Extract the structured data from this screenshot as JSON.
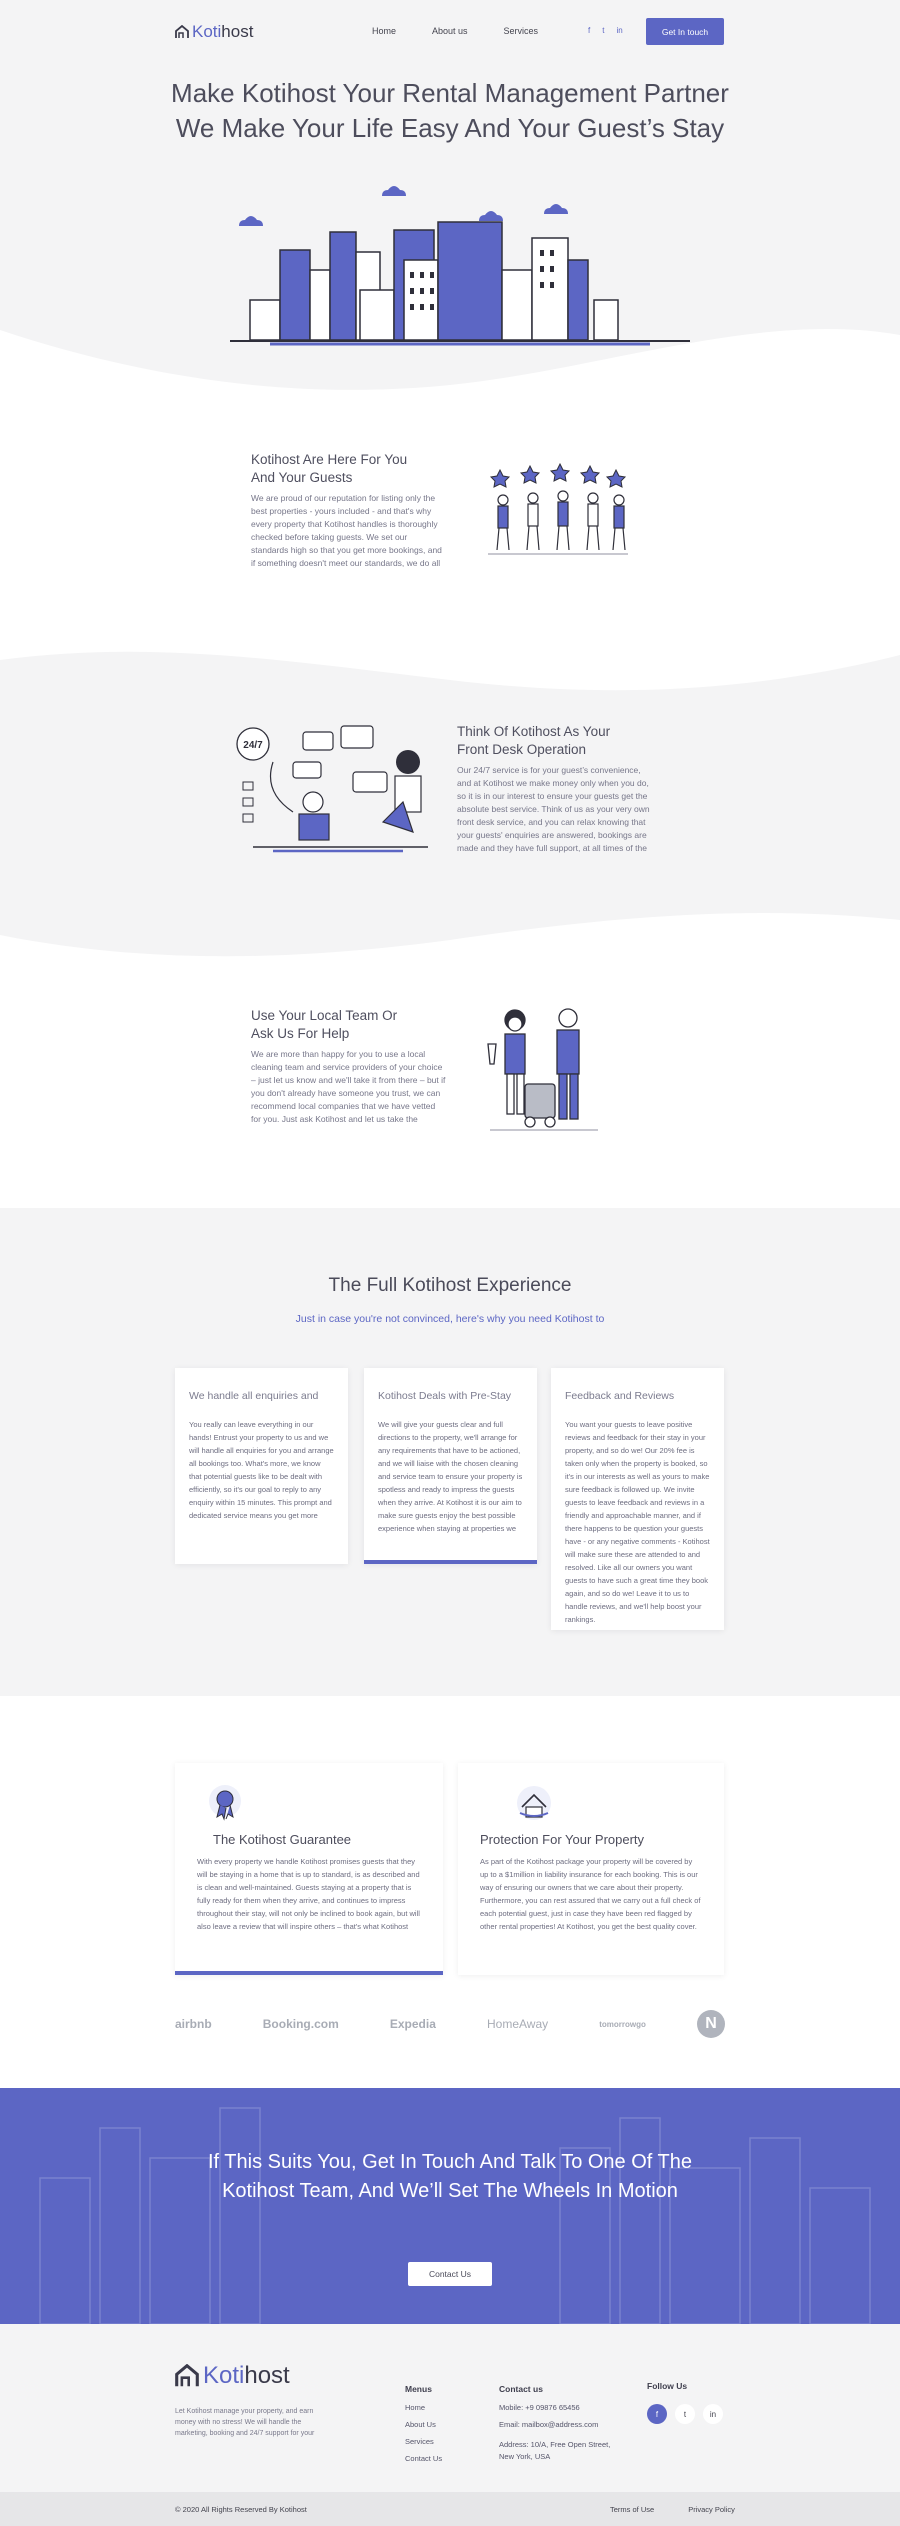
{
  "header": {
    "brand_prefix": "Koti",
    "brand_suffix": "host",
    "nav": [
      "Home",
      "About us",
      "Services"
    ],
    "socials": [
      "f",
      "t",
      "in"
    ],
    "cta": "Get In touch"
  },
  "hero": {
    "line1": "Make Kotihost Your Rental Management Partner",
    "line2": "We Make Your Life Easy And Your Guest’s Stay"
  },
  "features": [
    {
      "title_line1": "Kotihost Are Here For You",
      "title_line2": "And Your Guests",
      "body": "We are proud of our reputation for listing only the best properties - yours included - and that's why every property that Kotihost handles is thoroughly checked before taking guests. We set our standards high so that you get more bookings, and if something doesn't meet our standards, we do all"
    },
    {
      "title_line1": "Think Of Kotihost As Your",
      "title_line2": "Front Desk Operation",
      "body": "Our 24/7 service is for your guest’s convenience, and at Kotihost we make money only when you do, so it is in our interest to ensure your guests get the absolute best service. Think of us as your very own front desk service, and you can relax knowing that your guests' enquiries are answered, bookings are made and they have full support, at all times of the"
    },
    {
      "title_line1": "Use Your Local Team Or",
      "title_line2": "Ask Us For Help",
      "body": "We are more than happy for you to use a local cleaning team and service providers of your choice – just let us know and we'll take it from there – but if you don't already have someone you trust, we can recommend local companies that we have vetted for you. Just ask Kotihost and let us take the"
    }
  ],
  "badge_247": "24/7",
  "experience": {
    "title": "The Full Kotihost Experience",
    "subtitle": "Just in case you're not convinced, here's why you need Kotihost to",
    "cards": [
      {
        "title": "We handle all enquiries and",
        "body": "You really can leave everything in our hands! Entrust your property to us and we will handle all enquiries for you and arrange all bookings too. What's more, we know that potential guests like to be dealt with efficiently, so it's our goal to reply to any enquiry within 15 minutes. This prompt and dedicated service means you get more"
      },
      {
        "title": "Kotihost Deals with Pre-Stay",
        "body": "We will give your guests clear and full directions to the property, we'll arrange for any requirements that have to be actioned, and we will liaise with the chosen cleaning and service team to ensure your property is spotless and ready to impress the guests when they arrive. At Kotihost it is our aim to make sure guests enjoy the best possible experience when staying at properties we"
      },
      {
        "title": "Feedback and Reviews",
        "body": "You want your guests to leave positive reviews and feedback for their stay in your property, and so do we! Our 20% fee is taken only when the property is booked, so it's in our interests as well as yours to make sure feedback is followed up. We invite guests to leave feedback and reviews in a friendly and approachable manner, and if there happens to be question your guests have - or any negative comments - Kotihost will make sure these are attended to and resolved. Like all our owners you want guests to have such a great time they book again, and so do we! Leave it to us to handle reviews, and we'll help boost your rankings."
      }
    ]
  },
  "guarantees": [
    {
      "title": "The Kotihost Guarantee",
      "body": "With every property we handle Kotihost promises guests that they will be staying in a home that is up to standard, is as described and is clean and well-maintained. Guests staying at a property that is fully ready for them when they arrive, and continues to impress throughout their stay, will not only be inclined to book again, but will also leave a review that will inspire others – that's what Kotihost"
    },
    {
      "title": "Protection For Your Property",
      "body": "As part of the Kotihost package your property will be covered by up to a $1million in liability insurance for each booking. This is our way of ensuring our owners that we care about their property. Furthermore, you can rest assured that we carry out a full check of each potential guest, just in case they have been red flagged by other rental properties! At Kotihost, you get the best quality cover."
    }
  ],
  "partners": [
    "airbnb",
    "Booking.com",
    "Expedia",
    "HomeAway",
    "tomorrowgo",
    "N"
  ],
  "banner": {
    "line1": "If This Suits You, Get In Touch And Talk To One Of The",
    "line2": "Kotihost Team, And We’ll Set The Wheels In Motion",
    "button": "Contact Us"
  },
  "footer": {
    "brand_prefix": "Koti",
    "brand_suffix": "host",
    "desc": "Let Kotihost manage your property, and earn money with no stress! We will handle the marketing, booking and 24/7 support for your",
    "menus_title": "Menus",
    "menus": [
      "Home",
      "About Us",
      "Services",
      "Contact Us"
    ],
    "contact_title": "Contact us",
    "mobile": "Mobile: +9 09876 65456",
    "email": "Email: mailbox@address.com",
    "address_line1": "Address: 10/A, Free Open Street,",
    "address_line2": "New York, USA",
    "follow_title": "Follow Us",
    "socials": [
      "f",
      "t",
      "in"
    ],
    "copyright": "© 2020 All Rights Reserved By Kotihost",
    "terms": "Terms of Use",
    "privacy": "Privacy Policy"
  },
  "colors": {
    "accent": "#5c66c4",
    "background": "#f4f4f5",
    "card": "#ffffff"
  }
}
